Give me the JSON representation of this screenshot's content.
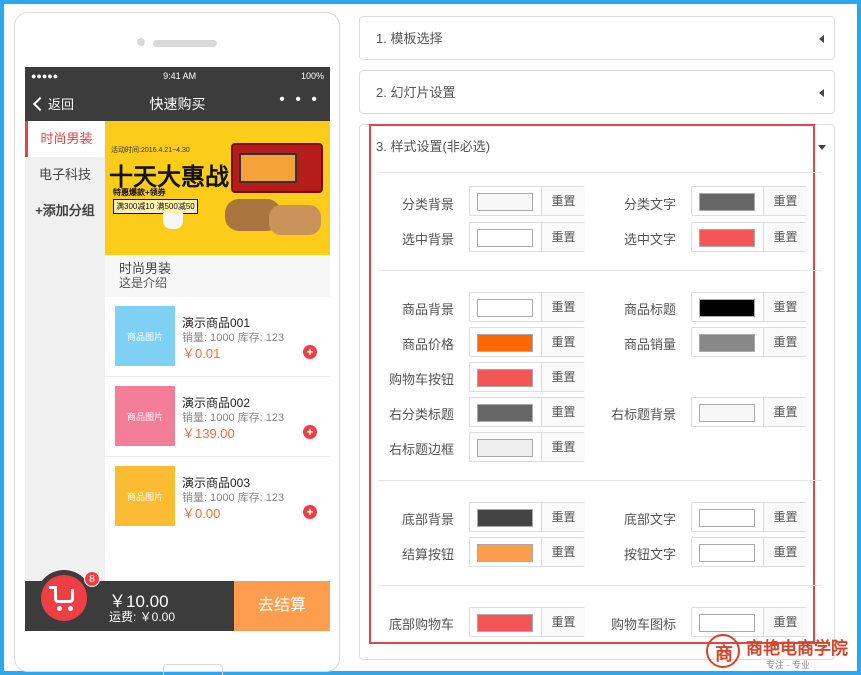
{
  "phone": {
    "status": {
      "carrier": "●●●●● ",
      "time": "9:41 AM",
      "battery": "100%"
    },
    "nav": {
      "back": "返回",
      "title": "快速购买",
      "more": "• • •"
    },
    "sidebar": [
      {
        "label": "时尚男装"
      },
      {
        "label": "电子科技"
      },
      {
        "label": "+添加分组"
      }
    ],
    "banner": {
      "time_text": "活动时间:2016.4.21~4.30",
      "headline": "十天大惠战",
      "tag": "特惠爆款+领券",
      "deal": "满300减10 满500减50"
    },
    "category": {
      "name": "时尚男装",
      "desc": "这是介绍"
    },
    "products": [
      {
        "image_label": "商品图片",
        "name": "演示商品001",
        "meta": "销量: 1000 库存: 123",
        "price": "￥0.01",
        "color": "#7fd0f5"
      },
      {
        "image_label": "商品图片",
        "name": "演示商品002",
        "meta": "销量: 1000 库存: 123",
        "price": "￥139.00",
        "color": "#f47d97"
      },
      {
        "image_label": "商品图片",
        "name": "演示商品003",
        "meta": "销量: 1000 库存: 123",
        "price": "￥0.00",
        "color": "#fbbb33"
      }
    ],
    "cart": {
      "badge": "8",
      "total": "￥10.00",
      "shipping": "运费: ￥0.00",
      "checkout": "去结算"
    }
  },
  "panels": {
    "p1": "1. 模板选择",
    "p2": "2. 幻灯片设置",
    "p3": "3. 样式设置(非必选)"
  },
  "reset_label": "重置",
  "styles": {
    "cat_bg": {
      "label": "分类背景",
      "color": "#f7f7f7"
    },
    "cat_text": {
      "label": "分类文字",
      "color": "#666666"
    },
    "sel_bg": {
      "label": "选中背景",
      "color": "#ffffff"
    },
    "sel_text": {
      "label": "选中文字",
      "color": "#f45555"
    },
    "goods_bg": {
      "label": "商品背景",
      "color": "#ffffff"
    },
    "goods_title": {
      "label": "商品标题",
      "color": "#000000"
    },
    "goods_price": {
      "label": "商品价格",
      "color": "#ff6600"
    },
    "goods_sales": {
      "label": "商品销量",
      "color": "#888888"
    },
    "cart_btn": {
      "label": "购物车按钮",
      "color": "#f45555"
    },
    "right_cat_title": {
      "label": "右分类标题",
      "color": "#666666"
    },
    "right_title_bg": {
      "label": "右标题背景",
      "color": "#f7f7f7"
    },
    "right_title_border": {
      "label": "右标题边框",
      "color": "#efefef"
    },
    "bottom_bg": {
      "label": "底部背景",
      "color": "#444444"
    },
    "bottom_text": {
      "label": "底部文字",
      "color": "#ffffff"
    },
    "checkout_btn": {
      "label": "结算按钮",
      "color": "#ff9d4e"
    },
    "btn_text": {
      "label": "按钮文字",
      "color": "#ffffff"
    },
    "bottom_cart": {
      "label": "底部购物车",
      "color": "#f45555"
    },
    "cart_icon": {
      "label": "购物车图标",
      "color": "#ffffff"
    }
  },
  "logo": {
    "glyph": "商",
    "name": "商艳电商学院",
    "slogan": "专注 · 专业"
  }
}
